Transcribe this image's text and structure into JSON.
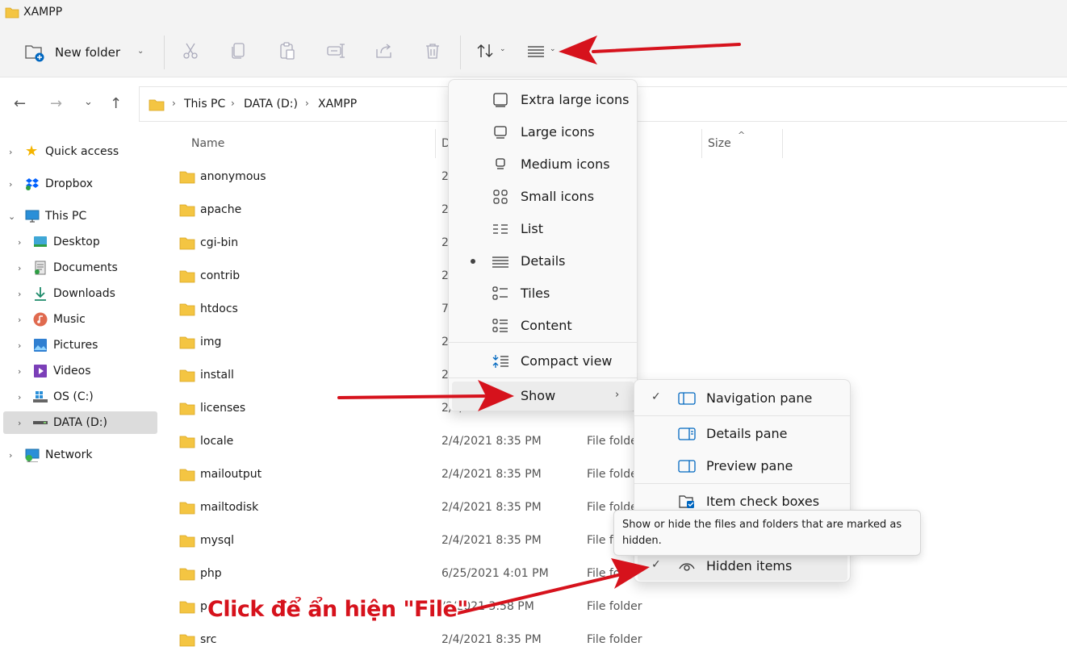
{
  "window": {
    "title": "XAMPP"
  },
  "toolbar": {
    "new_folder_label": "New folder",
    "icons": [
      "cut-icon",
      "copy-icon",
      "paste-icon",
      "rename-icon",
      "share-icon",
      "delete-icon",
      "sort-icon",
      "view-icon"
    ]
  },
  "address": {
    "crumbs": [
      "This PC",
      "DATA (D:)",
      "XAMPP"
    ]
  },
  "sidebar": {
    "items": [
      {
        "label": "Quick access"
      },
      {
        "label": "Dropbox"
      },
      {
        "label": "This PC"
      },
      {
        "label": "Desktop"
      },
      {
        "label": "Documents"
      },
      {
        "label": "Downloads"
      },
      {
        "label": "Music"
      },
      {
        "label": "Pictures"
      },
      {
        "label": "Videos"
      },
      {
        "label": "OS (C:)"
      },
      {
        "label": "DATA (D:)"
      },
      {
        "label": "Network"
      }
    ]
  },
  "columns": {
    "name": "Name",
    "date": "D",
    "size": "Size"
  },
  "files": [
    {
      "name": "anonymous",
      "date": "2",
      "type": "der"
    },
    {
      "name": "apache",
      "date": "2",
      "type": "r"
    },
    {
      "name": "cgi-bin",
      "date": "2",
      "type": "r"
    },
    {
      "name": "contrib",
      "date": "2",
      "type": "r"
    },
    {
      "name": "htdocs",
      "date": "7",
      "type": "r"
    },
    {
      "name": "img",
      "date": "2",
      "type": "r"
    },
    {
      "name": "install",
      "date": "2",
      "type": "r"
    },
    {
      "name": "licenses",
      "date": "2/4/2021 8:35 PM",
      "type": "File folder"
    },
    {
      "name": "locale",
      "date": "2/4/2021 8:35 PM",
      "type": "File folder"
    },
    {
      "name": "mailoutput",
      "date": "2/4/2021 8:35 PM",
      "type": "File folder"
    },
    {
      "name": "mailtodisk",
      "date": "2/4/2021 8:35 PM",
      "type": "File folder"
    },
    {
      "name": "mysql",
      "date": "2/4/2021 8:35 PM",
      "type": "File folder"
    },
    {
      "name": "php",
      "date": "6/25/2021 4:01 PM",
      "type": "File folder"
    },
    {
      "name": "p",
      "date": "/8/2021 3:58 PM",
      "type": "File folder"
    },
    {
      "name": "src",
      "date": "2/4/2021 8:35 PM",
      "type": "File folder"
    }
  ],
  "view_menu": {
    "items": [
      {
        "label": "Extra large icons",
        "icon": "extra-large-icons-icon"
      },
      {
        "label": "Large icons",
        "icon": "large-icons-icon"
      },
      {
        "label": "Medium icons",
        "icon": "medium-icons-icon"
      },
      {
        "label": "Small icons",
        "icon": "small-icons-icon"
      },
      {
        "label": "List",
        "icon": "list-icon"
      },
      {
        "label": "Details",
        "icon": "details-icon",
        "selected": true
      },
      {
        "label": "Tiles",
        "icon": "tiles-icon"
      },
      {
        "label": "Content",
        "icon": "content-icon"
      },
      {
        "label": "Compact view",
        "icon": "compact-view-icon"
      },
      {
        "label": "Show",
        "icon": "",
        "has_submenu": true
      }
    ]
  },
  "show_submenu": {
    "items": [
      {
        "label": "Navigation pane",
        "checked": true
      },
      {
        "label": "Details pane",
        "checked": false
      },
      {
        "label": "Preview pane",
        "checked": false
      },
      {
        "label": "Item check boxes",
        "checked": false
      },
      {
        "label": "Hidden items",
        "checked": true
      }
    ]
  },
  "tooltip": {
    "text": "Show or hide the files and folders that are marked as hidden."
  },
  "annotation": {
    "caption": "Click để ẩn hiện \"File\"",
    "color": "#d6121c"
  },
  "colors": {
    "accent": "#0067c0",
    "folder": "#f4c542",
    "selection": "#dcdcdc"
  }
}
